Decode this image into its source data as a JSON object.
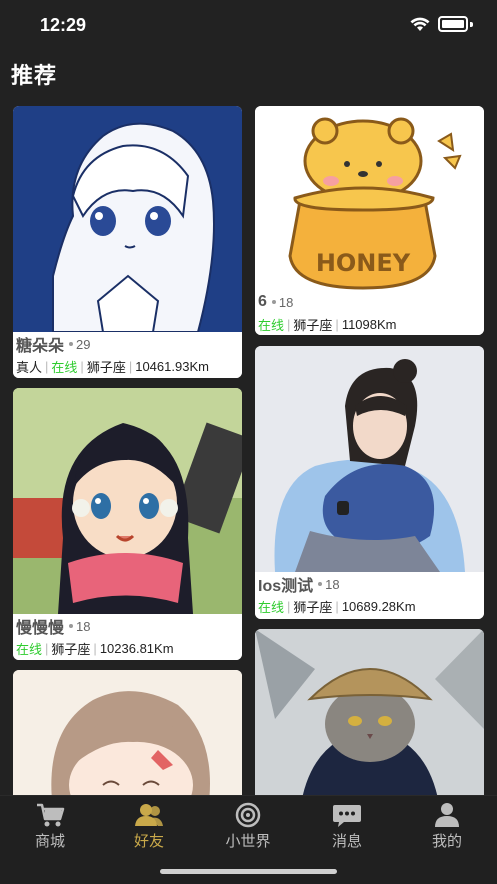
{
  "status": {
    "time": "12:29"
  },
  "page": {
    "title": "推荐"
  },
  "cards": [
    {
      "name": "糖朵朵",
      "age": "29",
      "tags": [
        "真人",
        "在线",
        "狮子座",
        "10461.93Km"
      ]
    },
    {
      "name": "6",
      "age": "18",
      "tags": [
        "在线",
        "狮子座",
        "11098Km"
      ]
    },
    {
      "name": "慢慢慢",
      "age": "18",
      "tags": [
        "在线",
        "狮子座",
        "10236.81Km"
      ]
    },
    {
      "name": "Ios测试",
      "age": "18",
      "tags": [
        "在线",
        "狮子座",
        "10689.28Km"
      ]
    }
  ],
  "honey_text": "HONEY",
  "tabs": [
    {
      "label": "商城",
      "icon": "cart-icon"
    },
    {
      "label": "好友",
      "icon": "friends-icon"
    },
    {
      "label": "小世界",
      "icon": "world-icon"
    },
    {
      "label": "消息",
      "icon": "message-icon"
    },
    {
      "label": "我的",
      "icon": "profile-icon"
    }
  ],
  "active_tab": "好友",
  "colors": {
    "online": "#2ecc2e",
    "active_tab": "#c9a94a",
    "background": "#222222"
  }
}
